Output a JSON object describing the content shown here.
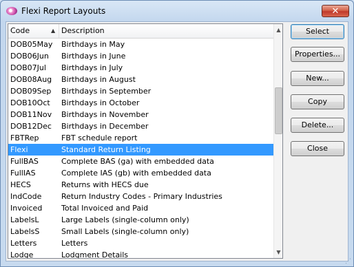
{
  "window": {
    "title": "Flexi Report Layouts",
    "close_glyph": "✕"
  },
  "list": {
    "columns": {
      "code": "Code",
      "description": "Description"
    },
    "sort_glyph": "▲",
    "rows": [
      {
        "code": "DOB05May",
        "description": "Birthdays in May"
      },
      {
        "code": "DOB06Jun",
        "description": "Birthdays in June"
      },
      {
        "code": "DOB07Jul",
        "description": "Birthdays in July"
      },
      {
        "code": "DOB08Aug",
        "description": "Birthdays in August"
      },
      {
        "code": "DOB09Sep",
        "description": "Birthdays in September"
      },
      {
        "code": "DOB10Oct",
        "description": "Birthdays in October"
      },
      {
        "code": "DOB11Nov",
        "description": "Birthdays in November"
      },
      {
        "code": "DOB12Dec",
        "description": "Birthdays in December"
      },
      {
        "code": "FBTRep",
        "description": "FBT schedule report"
      },
      {
        "code": "Flexi",
        "description": "Standard Return Listing",
        "selected": true
      },
      {
        "code": "FullBAS",
        "description": "Complete BAS (ga) with embedded data"
      },
      {
        "code": "FullIAS",
        "description": "Complete IAS (gb) with embedded data"
      },
      {
        "code": "HECS",
        "description": "Returns with HECS due"
      },
      {
        "code": "IndCode",
        "description": "Return Industry Codes - Primary Industries"
      },
      {
        "code": "Invoiced",
        "description": "Total Invoiced and Paid"
      },
      {
        "code": "LabelsL",
        "description": "Large Labels (single-column only)"
      },
      {
        "code": "LabelsS",
        "description": "Small Labels (single-column only)"
      },
      {
        "code": "Letters",
        "description": "Letters"
      },
      {
        "code": "Lodge",
        "description": "Lodgment Details"
      }
    ],
    "scroll_up_glyph": "▲",
    "scroll_down_glyph": "▼"
  },
  "buttons": {
    "select": "Select",
    "properties": "Properties...",
    "new": "New...",
    "copy": "Copy",
    "delete": "Delete...",
    "close": "Close"
  },
  "colors": {
    "selection": "#3399ff"
  }
}
